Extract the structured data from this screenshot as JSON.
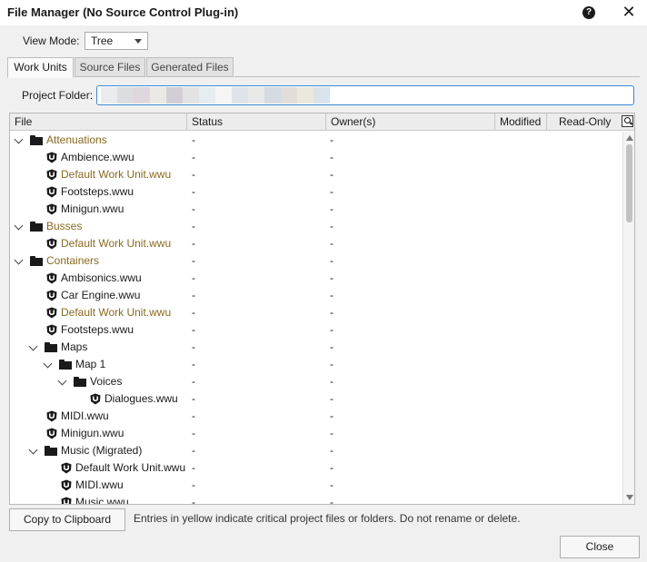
{
  "window": {
    "title": "File Manager (No Source Control Plug-in)"
  },
  "view_mode": {
    "label": "View Mode:",
    "value": "Tree"
  },
  "tabs": [
    {
      "label": "Work Units",
      "active": true
    },
    {
      "label": "Source Files",
      "active": false
    },
    {
      "label": "Generated Files",
      "active": false
    }
  ],
  "project_folder": {
    "label": "Project Folder:",
    "value_obscured": true
  },
  "grid": {
    "columns": [
      "File",
      "Status",
      "Owner(s)",
      "Modified",
      "Read-Only"
    ],
    "rows": [
      {
        "name": "Attenuations",
        "kind": "folder",
        "level": 0,
        "expanded": true,
        "critical": true,
        "status": "-",
        "owner": "-"
      },
      {
        "name": "Ambience.wwu",
        "kind": "wwu",
        "level": 1,
        "critical": false,
        "status": "-",
        "owner": "-"
      },
      {
        "name": "Default Work Unit.wwu",
        "kind": "wwu",
        "level": 1,
        "critical": true,
        "status": "-",
        "owner": "-"
      },
      {
        "name": "Footsteps.wwu",
        "kind": "wwu",
        "level": 1,
        "critical": false,
        "status": "-",
        "owner": "-"
      },
      {
        "name": "Minigun.wwu",
        "kind": "wwu",
        "level": 1,
        "critical": false,
        "status": "-",
        "owner": "-"
      },
      {
        "name": "Busses",
        "kind": "folder",
        "level": 0,
        "expanded": true,
        "critical": true,
        "status": "-",
        "owner": "-"
      },
      {
        "name": "Default Work Unit.wwu",
        "kind": "wwu",
        "level": 1,
        "critical": true,
        "status": "-",
        "owner": "-"
      },
      {
        "name": "Containers",
        "kind": "folder",
        "level": 0,
        "expanded": true,
        "critical": true,
        "status": "-",
        "owner": "-"
      },
      {
        "name": "Ambisonics.wwu",
        "kind": "wwu",
        "level": 1,
        "critical": false,
        "status": "-",
        "owner": "-"
      },
      {
        "name": "Car Engine.wwu",
        "kind": "wwu",
        "level": 1,
        "critical": false,
        "status": "-",
        "owner": "-"
      },
      {
        "name": "Default Work Unit.wwu",
        "kind": "wwu",
        "level": 1,
        "critical": true,
        "status": "-",
        "owner": "-"
      },
      {
        "name": "Footsteps.wwu",
        "kind": "wwu",
        "level": 1,
        "critical": false,
        "status": "-",
        "owner": "-"
      },
      {
        "name": "Maps",
        "kind": "folder",
        "level": 1,
        "expanded": true,
        "critical": false,
        "status": "-",
        "owner": "-"
      },
      {
        "name": "Map 1",
        "kind": "folder",
        "level": 2,
        "expanded": true,
        "critical": false,
        "status": "-",
        "owner": "-"
      },
      {
        "name": "Voices",
        "kind": "folder",
        "level": 3,
        "expanded": true,
        "critical": false,
        "status": "-",
        "owner": "-"
      },
      {
        "name": "Dialogues.wwu",
        "kind": "wwu",
        "level": 4,
        "critical": false,
        "status": "-",
        "owner": "-"
      },
      {
        "name": "MIDI.wwu",
        "kind": "wwu",
        "level": 1,
        "critical": false,
        "status": "-",
        "owner": "-"
      },
      {
        "name": "Minigun.wwu",
        "kind": "wwu",
        "level": 1,
        "critical": false,
        "status": "-",
        "owner": "-"
      },
      {
        "name": "Music (Migrated)",
        "kind": "folder",
        "level": 1,
        "expanded": true,
        "critical": false,
        "status": "-",
        "owner": "-"
      },
      {
        "name": "Default Work Unit.wwu",
        "kind": "wwu",
        "level": 2,
        "critical": false,
        "status": "-",
        "owner": "-"
      },
      {
        "name": "MIDI.wwu",
        "kind": "wwu",
        "level": 2,
        "critical": false,
        "status": "-",
        "owner": "-"
      },
      {
        "name": "Music.wwu",
        "kind": "wwu",
        "level": 2,
        "critical": false,
        "status": "-",
        "owner": "-"
      }
    ]
  },
  "footer": {
    "copy_label": "Copy to Clipboard",
    "hint": "Entries in yellow indicate critical project files or folders. Do not rename or delete.",
    "close_label": "Close"
  },
  "colors": {
    "critical_text": "#8a6a1e",
    "focus_border": "#3a8ad8"
  },
  "icons": {
    "help": "help-icon",
    "close": "close-icon",
    "folder": "folder-icon",
    "work_unit": "work-unit-icon",
    "expand": "chevron-down-icon",
    "grid_search": "search-icon"
  }
}
